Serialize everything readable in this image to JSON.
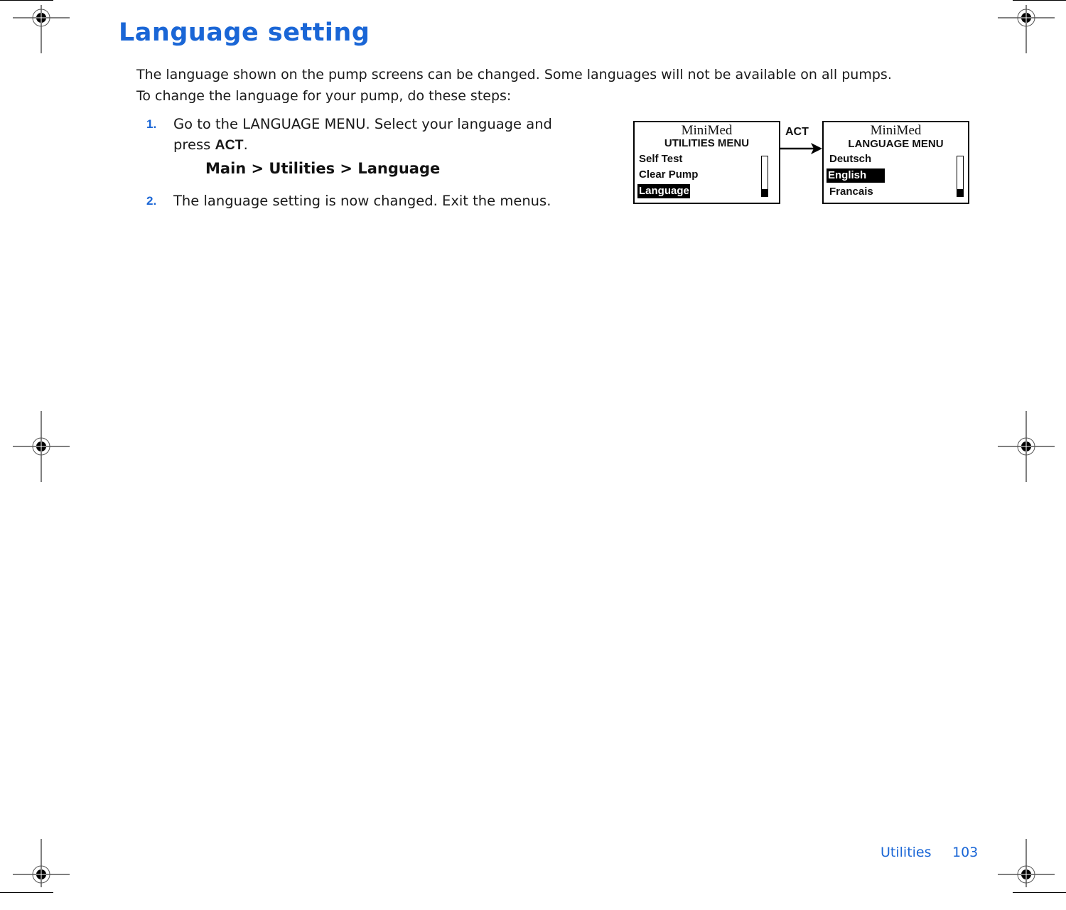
{
  "page": {
    "title": "Language setting",
    "intro": [
      "The language shown on the pump screens can be changed. Some languages will not be available on all pumps.",
      "To change the language for your pump, do these steps:"
    ],
    "steps": [
      {
        "number": "1.",
        "text_before": "Go to the LANGUAGE MENU. Select your language and press ",
        "bold": "ACT",
        "text_after": "."
      },
      {
        "number": "2.",
        "text": "The language setting is now changed. Exit the menus."
      }
    ],
    "menu_path": "Main > Utilities > Language"
  },
  "diagram": {
    "action_label": "ACT",
    "screens": [
      {
        "brand": "MiniMed",
        "title": "UTILITIES MENU",
        "items": [
          "Self Test",
          "Clear Pump",
          "Language"
        ],
        "selected": "Language",
        "scroll_position": "bottom"
      },
      {
        "brand": "MiniMed",
        "title": "LANGUAGE MENU",
        "items": [
          "Deutsch",
          "English",
          "Francais"
        ],
        "selected": "English",
        "scroll_position": "bottom"
      }
    ]
  },
  "footer": {
    "section": "Utilities",
    "page_number": "103"
  },
  "colors": {
    "accent": "#1a66d6",
    "text": "#1a1a1a"
  }
}
